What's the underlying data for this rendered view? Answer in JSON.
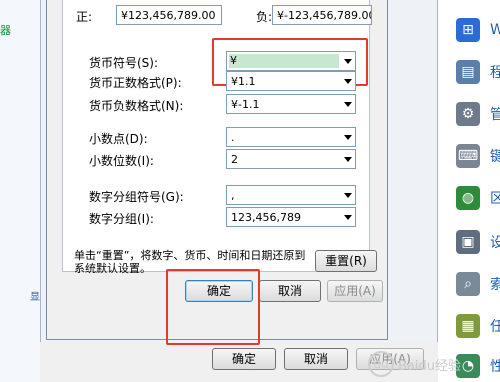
{
  "left_panel": {
    "text": "器",
    "mark": "显"
  },
  "right_panel": {
    "items": [
      {
        "label": "W",
        "icon": "windows-flag-icon",
        "color": "#2a6bd6"
      },
      {
        "label": "程",
        "icon": "programs-icon",
        "color": "#5a7fa8"
      },
      {
        "label": "管",
        "icon": "admin-tools-icon",
        "color": "#6d7b8d"
      },
      {
        "label": "键",
        "icon": "keyboard-icon",
        "color": "#7b8694"
      },
      {
        "label": "区",
        "icon": "globe-clock-icon",
        "color": "#2f8a3a"
      },
      {
        "label": "设",
        "icon": "device-icon",
        "color": "#5e6d80"
      },
      {
        "label": "索",
        "icon": "search-magnifier-icon",
        "color": "#7a8a99"
      },
      {
        "label": "任",
        "icon": "taskbar-icon",
        "color": "#7e9a3a"
      },
      {
        "label": "性",
        "icon": "performance-icon",
        "color": "#3a8a5a"
      }
    ]
  },
  "example": {
    "positive_label": "正:",
    "positive_value": "¥123,456,789.00",
    "negative_label": "负:",
    "negative_value": "¥-123,456,789.00"
  },
  "fields": {
    "currency_symbol": {
      "label": "货币符号(S):",
      "value": "¥"
    },
    "positive_format": {
      "label": "货币正数格式(P):",
      "value": "¥1.1"
    },
    "negative_format": {
      "label": "货币负数格式(N):",
      "value": "¥-1.1"
    },
    "decimal_symbol": {
      "label": "小数点(D):",
      "value": "."
    },
    "decimal_digits": {
      "label": "小数位数(I):",
      "value": "2"
    },
    "group_symbol": {
      "label": "数字分组符号(G):",
      "value": ","
    },
    "grouping": {
      "label": "数字分组(I):",
      "value": "123,456,789"
    }
  },
  "note": "单击“重置”，将数字、货币、时间和日期还原到系统默认设置。",
  "buttons": {
    "reset": "重置(R)",
    "ok": "确定",
    "cancel": "取消",
    "apply": "应用(A)"
  },
  "outer_buttons": {
    "ok": "确定",
    "cancel": "取消",
    "apply": "应用(A)"
  },
  "watermark": {
    "text": "Baidu经验",
    "icon": "du"
  },
  "colors": {
    "highlight": "#e23b2e",
    "selection": "#c8e6d0",
    "link_blue": "#1e5fb4"
  }
}
